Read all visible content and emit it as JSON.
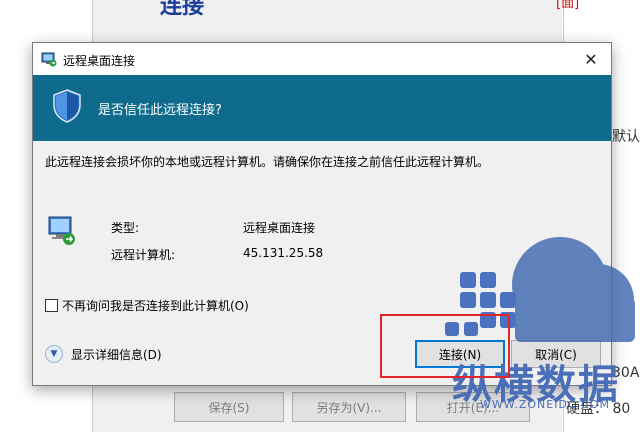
{
  "background": {
    "heading": "连接",
    "link": "[面]",
    "side_text_1": "默认",
    "side_text_2": "30A",
    "side_text_3": "硬盘： 80",
    "buttons": [
      "保存(S)",
      "另存为(V)...",
      "打开(E)..."
    ]
  },
  "watermark": {
    "brand": "纵横数据",
    "url": "WWW.ZONEIDC.COM"
  },
  "dialog": {
    "title": "远程桌面连接",
    "question": "是否信任此远程连接?",
    "warning": "此远程连接会损坏你的本地或远程计算机。请确保你在连接之前信任此远程计算机。",
    "rows": [
      {
        "label": "类型:",
        "value": "远程桌面连接"
      },
      {
        "label": "远程计算机:",
        "value": "45.131.25.58"
      }
    ],
    "checkbox_label": "不再询问我是否连接到此计算机(O)",
    "details_label": "显示详细信息(D)",
    "connect_label": "连接(N)",
    "cancel_label": "取消(C)"
  },
  "colors": {
    "banner": "#0f6b8c",
    "highlight": "#e0262b",
    "watermark": "#4a6eb8"
  }
}
